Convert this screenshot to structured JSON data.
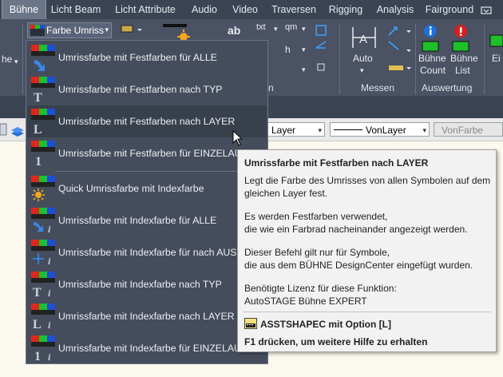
{
  "tabs": [
    "Bühne",
    "Licht Beam",
    "Licht Attribute",
    "Audio",
    "Video",
    "Traversen",
    "Rigging",
    "Analysis",
    "Fairground"
  ],
  "ribbon": {
    "farbe_umriss_label": "Farbe Umriss",
    "txt_label": "txt",
    "qm_label": "qm",
    "ab_label": "ab",
    "auto_label": "Auto",
    "messen_label": "Messen",
    "buehne_count_l1": "Bühne",
    "buehne_count_l2": "Count",
    "buehne_list_l1": "Bühne",
    "buehne_list_l2": "List",
    "auswertung_label": "Auswertung",
    "ei_label": "Ei",
    "left_frag": "he",
    "n_frag": "n"
  },
  "props": {
    "layer": "Layer",
    "linetype": "VonLayer",
    "color": "VonFarbe"
  },
  "menu": {
    "items": [
      "Umrissfarbe mit Festfarben für ALLE",
      "Umrissfarbe mit Festfarben nach TYP",
      "Umrissfarbe mit Festfarben nach LAYER",
      "Umrissfarbe mit Festfarben für EINZELAUSWAHL",
      "Quick Umrissfarbe mit Indexfarbe",
      "Umrissfarbe mit Indexfarbe für ALLE",
      "Umrissfarbe mit Indexfarbe für nach AUSWAHL",
      "Umrissfarbe mit Indexfarbe nach TYP",
      "Umrissfarbe mit Indexfarbe nach LAYER",
      "Umrissfarbe mit Indexfarbe für EINZELAUSWAHL"
    ]
  },
  "tooltip": {
    "title": "Umrissfarbe mit Festfarben nach LAYER",
    "p1a": "Legt die Farbe des Umrisses von allen Symbolen auf dem",
    "p1b": "gleichen Layer fest.",
    "p2a": "Es werden Festfarben verwendet,",
    "p2b": "die wie ein Farbrad nacheinander angezeigt werden.",
    "p3a": "Dieser Befehl gilt nur für Symbole,",
    "p3b": "die aus dem BÜHNE DesignCenter eingefügt wurden.",
    "p4a": "Benötigte Lizenz für diese Funktion:",
    "p4b": "AutoSTAGE Bühne EXPERT",
    "command": "ASSTSHAPEC mit Option [L]",
    "f1": "F1 drücken, um weitere Hilfe zu erhalten"
  },
  "colors": {
    "tabbar": "#3b4453",
    "ribbon": "#4a5263",
    "menu": "#454d5c",
    "menu_highlight": "#38404c",
    "tooltip_bg": "#f2f2f2",
    "icon_red": "#e0261f",
    "icon_green": "#1fbf2a",
    "icon_blue": "#1d4fd6"
  },
  "icons": [
    "color-swatch-icon",
    "arrow-down-icon",
    "text-t-icon",
    "layer-l-icon",
    "number-1-icon",
    "sun-icon",
    "crosshair-icon",
    "info-icon",
    "warning-icon",
    "keyboard-icon",
    "cursor-icon"
  ]
}
